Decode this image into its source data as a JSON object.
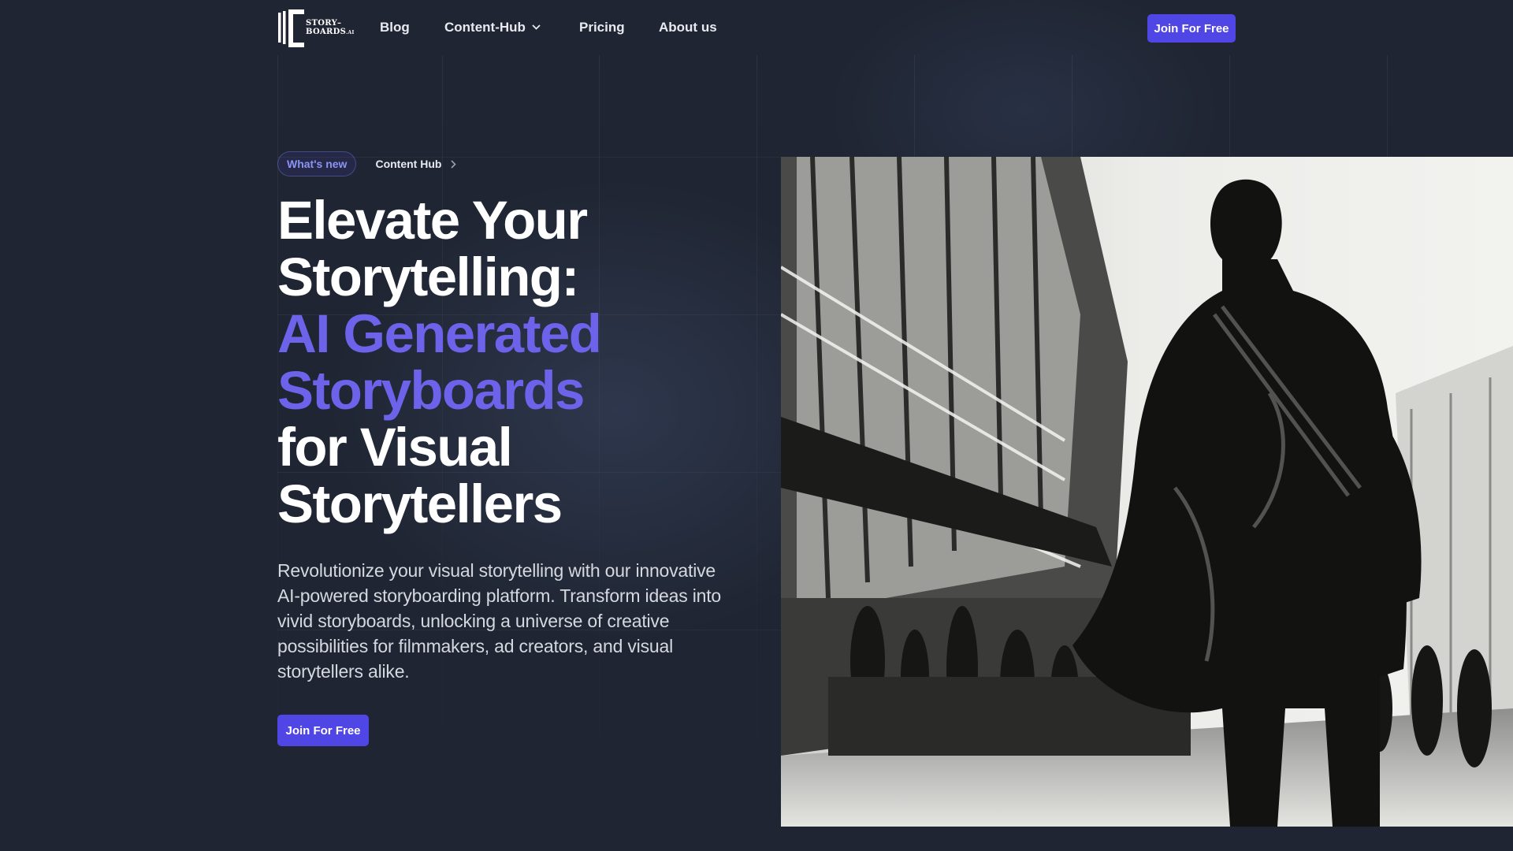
{
  "brand": {
    "logo_line1": "STORY–",
    "logo_line2": "BOARDS",
    "logo_suffix": ".AI"
  },
  "nav": {
    "items": [
      {
        "label": "Blog"
      },
      {
        "label": "Content-Hub",
        "has_dropdown": true
      },
      {
        "label": "Pricing"
      },
      {
        "label": "About us"
      }
    ],
    "cta_label": "Join For Free"
  },
  "hero": {
    "badge": "What's new",
    "badge_link": "Content Hub",
    "headline": {
      "line1": "Elevate Your",
      "line2": "Storytelling:",
      "accent_line1": "AI Generated",
      "accent_line2": "Storyboards",
      "line5": "for Visual",
      "line6": "Storytellers"
    },
    "description": "Revolutionize your visual storytelling with our innovative AI-powered storyboarding platform. Transform ideas into vivid storyboards, unlocking a universe of creative possibilities for filmmakers, ad creators, and visual storytellers alike.",
    "cta_label": "Join For Free",
    "image_icon": "storyboard-illustration"
  },
  "colors": {
    "background": "#1f2532",
    "accent": "#6c63ea",
    "button": "#4f46e5",
    "text": "#ffffff",
    "muted_text": "#d5d8df"
  }
}
